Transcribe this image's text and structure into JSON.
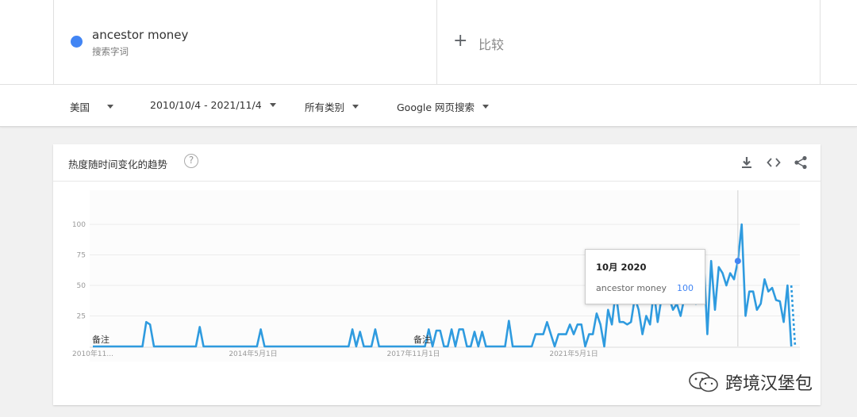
{
  "search_term": {
    "name": "ancestor money",
    "subtitle": "搜索字词",
    "color": "#4285f4"
  },
  "compare": {
    "plus": "+",
    "label": "比较"
  },
  "filters": {
    "region": "美国",
    "date_range": "2010/10/4 - 2021/11/4",
    "category": "所有类别",
    "search_type": "Google 网页搜索"
  },
  "card": {
    "title": "热度随时间变化的趋势",
    "help": "?",
    "icons": [
      "download-icon",
      "embed-code-icon",
      "share-icon"
    ]
  },
  "chart_data": {
    "type": "line",
    "ylim": [
      0,
      100
    ],
    "y_ticks": [
      "100",
      "75",
      "50",
      "25"
    ],
    "y_tick_values": [
      100,
      75,
      50,
      25
    ],
    "x_tick_labels": [
      "2010年11...",
      "2014年5月1日",
      "2017年11月1日",
      "2021年5月1日"
    ],
    "annotations": [
      "备注",
      "备注"
    ],
    "series": [
      {
        "values": [
          0,
          0,
          0,
          0,
          0,
          0,
          0,
          0,
          0,
          0,
          0,
          0,
          0,
          0,
          20,
          18,
          0,
          0,
          0,
          0,
          0,
          0,
          0,
          0,
          0,
          0,
          0,
          0,
          16,
          0,
          0,
          0,
          0,
          0,
          0,
          0,
          0,
          0,
          0,
          0,
          0,
          0,
          0,
          0,
          14,
          0,
          0,
          0,
          0,
          0,
          0,
          0,
          0,
          0,
          0,
          0,
          0,
          0,
          0,
          0,
          0,
          0,
          0,
          0,
          0,
          0,
          0,
          0,
          14,
          0,
          12,
          0,
          0,
          0,
          14,
          0,
          0,
          0,
          0,
          0,
          0,
          0,
          0,
          0,
          0,
          0,
          0,
          0,
          14,
          0,
          13,
          13,
          0,
          0,
          14,
          0,
          14,
          14,
          0,
          0,
          12,
          0,
          12,
          0,
          0,
          0,
          0,
          0,
          0,
          21,
          0,
          0,
          0,
          0,
          0,
          0,
          10,
          10,
          10,
          20,
          10,
          0,
          10,
          10,
          10,
          18,
          10,
          18,
          18,
          0,
          10,
          10,
          27,
          18,
          0,
          30,
          18,
          45,
          20,
          20,
          18,
          20,
          40,
          30,
          10,
          25,
          18,
          45,
          20,
          40,
          38,
          40,
          30,
          35,
          25,
          40,
          45,
          40,
          35,
          70,
          75,
          10,
          70,
          30,
          65,
          60,
          50,
          60,
          55,
          70,
          100,
          25,
          45,
          45,
          30,
          35,
          55,
          45,
          48,
          38,
          37,
          20,
          50,
          0
        ]
      }
    ],
    "partial_tail": [
      50,
      0
    ],
    "highlight_index": 169,
    "tooltip": {
      "date": "10月 2020",
      "term": "ancestor money",
      "value": "100"
    }
  },
  "watermark": {
    "text": "跨境汉堡包"
  }
}
